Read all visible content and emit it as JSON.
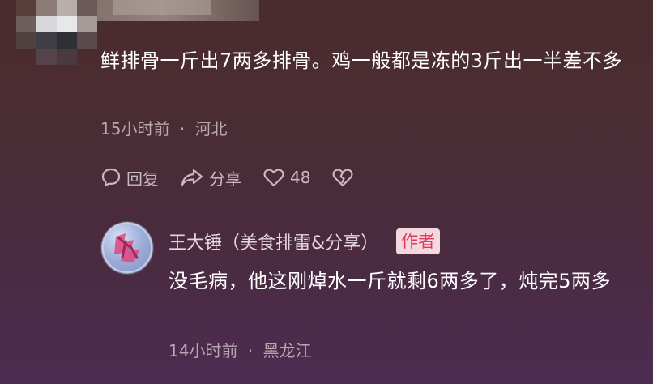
{
  "comment": {
    "text": "鲜排骨一斤出7两多排骨。鸡一般都是冻的3斤出一半差不多",
    "time": "15小时前",
    "separator": "·",
    "location": "河北",
    "actions": {
      "reply_label": "回复",
      "share_label": "分享",
      "like_count": "48"
    }
  },
  "reply": {
    "author": "王大锤（美食排雷&分享）",
    "author_badge": "作者",
    "text": "没毛病，他这刚焯水一斤就剩6两多了，炖完5两多",
    "time": "14小时前",
    "separator": "·",
    "location": "黑龙江"
  },
  "colors": {
    "background_top": "#4a2c2e",
    "background_bottom": "#4d2c52",
    "badge_bg": "#f3d9df",
    "badge_text": "#e23a5a",
    "meta_text": "#b9a8ae"
  },
  "icons": {
    "reply": "comment-bubble-icon",
    "share": "share-arrow-icon",
    "like": "heart-icon",
    "dislike": "broken-heart-icon"
  }
}
